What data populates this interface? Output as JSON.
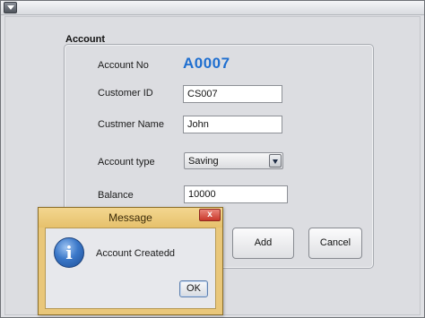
{
  "window": {
    "menu_icon": "chevron-down-icon"
  },
  "account_panel": {
    "title": "Account",
    "account_no_label": "Account No",
    "account_no_value": "A0007",
    "customer_id_label": "Customer ID",
    "customer_id_value": "CS007",
    "customer_name_label": "Custmer Name",
    "customer_name_value": "John",
    "account_type_label": "Account type",
    "account_type_value": "Saving",
    "balance_label": "Balance",
    "balance_value": "10000",
    "add_label": "Add",
    "cancel_label": "Cancel"
  },
  "dialog": {
    "title": "Message",
    "close_glyph": "x",
    "icon": "info-icon",
    "icon_glyph": "i",
    "message": "Account Createdd",
    "ok_label": "OK"
  },
  "colors": {
    "account_number": "#1f6fd0",
    "dialog_frame": "#e9c77a",
    "dialog_close": "#c9382b"
  }
}
